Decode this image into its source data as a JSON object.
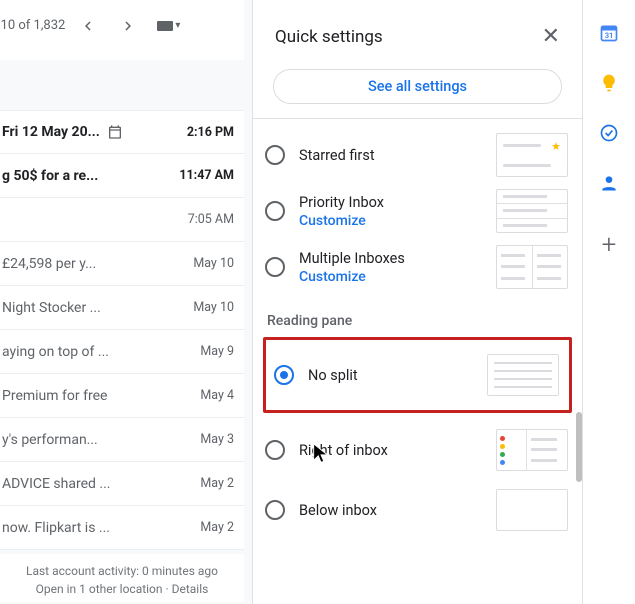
{
  "pager": {
    "range": "–10 of 1,832"
  },
  "emails": [
    {
      "subject": "Fri 12 May 20...",
      "time": "2:16 PM",
      "unread": true,
      "hasCal": true
    },
    {
      "subject": "g 50$ for a re...",
      "time": "11:47 AM",
      "unread": true,
      "hasCal": false
    },
    {
      "subject": "",
      "time": "7:05 AM",
      "unread": false,
      "hasCal": false
    },
    {
      "subject": "£24,598 per y...",
      "time": "May 10",
      "unread": false,
      "hasCal": false
    },
    {
      "subject": "Night Stocker ...",
      "time": "May 10",
      "unread": false,
      "hasCal": false
    },
    {
      "subject": "aying on top of ...",
      "time": "May 9",
      "unread": false,
      "hasCal": false
    },
    {
      "subject": "Premium for free",
      "time": "May 4",
      "unread": false,
      "hasCal": false
    },
    {
      "subject": "y's performan...",
      "time": "May 3",
      "unread": false,
      "hasCal": false
    },
    {
      "subject": "ADVICE shared ...",
      "time": "May 2",
      "unread": false,
      "hasCal": false
    },
    {
      "subject": "now. Flipkart is ...",
      "time": "May 2",
      "unread": false,
      "hasCal": false
    }
  ],
  "activity": {
    "line1": "Last account activity: 0 minutes ago",
    "line2": "Open in 1 other location · Details"
  },
  "quickSettings": {
    "title": "Quick settings",
    "seeAll": "See all settings",
    "inboxOptions": {
      "starred": {
        "label": "Starred first"
      },
      "priority": {
        "label": "Priority Inbox",
        "customize": "Customize"
      },
      "multiple": {
        "label": "Multiple Inboxes",
        "customize": "Customize"
      }
    },
    "readingPane": {
      "header": "Reading pane",
      "noSplit": "No split",
      "right": "Right of inbox",
      "below": "Below inbox"
    }
  },
  "rail": {
    "calendarDay": "31"
  }
}
